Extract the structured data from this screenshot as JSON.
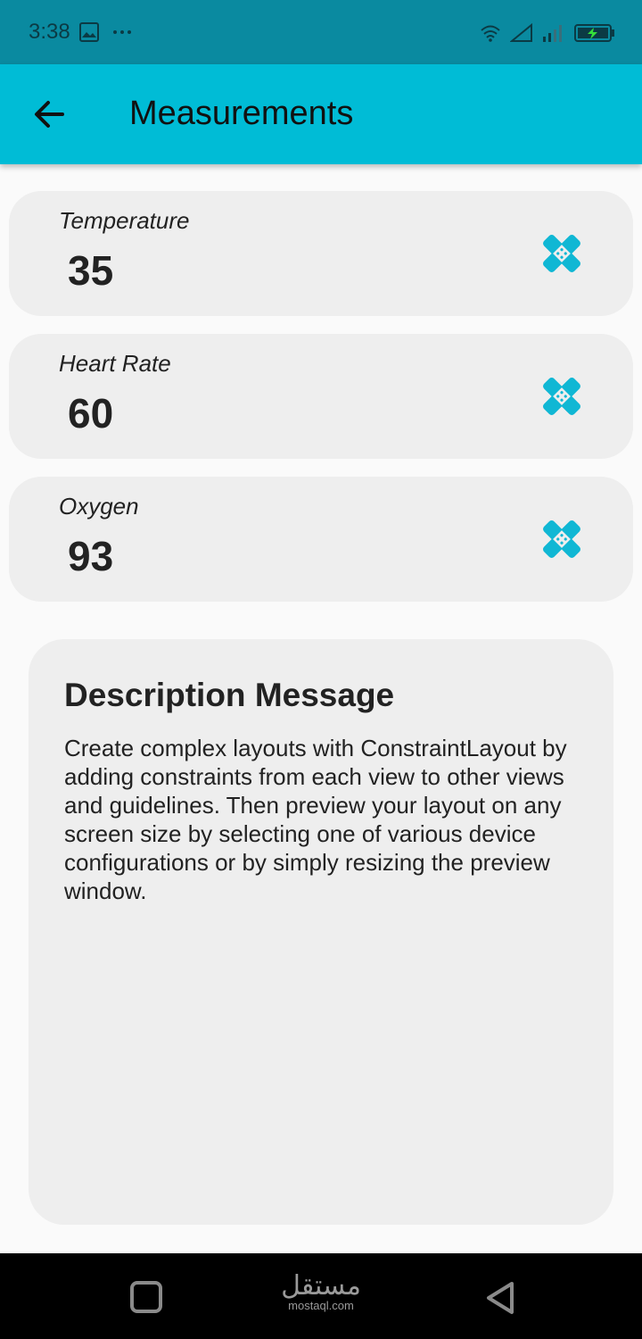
{
  "status_bar": {
    "time": "3:38",
    "left_icons": [
      "gallery-icon",
      "more-icon"
    ],
    "right_icons": [
      "wifi-icon",
      "signal-icon",
      "signal-bars-icon",
      "battery-charging-icon"
    ],
    "battery_color": "#35e03a"
  },
  "app_bar": {
    "title": "Measurements",
    "back_icon": "arrow-left-icon",
    "background": "#00bcd6"
  },
  "measurements": [
    {
      "label": "Temperature",
      "value": "35",
      "icon": "bandage-icon"
    },
    {
      "label": "Heart Rate",
      "value": "60",
      "icon": "bandage-icon"
    },
    {
      "label": "Oxygen",
      "value": "93",
      "icon": "bandage-icon"
    }
  ],
  "description": {
    "title": "Description Message",
    "body": "Create complex layouts with ConstraintLayout by adding constraints from each view to other views and guidelines. Then preview your layout on any screen size by selecting one of various device configurations or by simply resizing the preview window."
  },
  "nav_bar": {
    "home_icon": "square-icon",
    "watermark_ar": "مستقل",
    "watermark_en": "mostaql.com",
    "back_icon": "triangle-back-icon"
  },
  "colors": {
    "accent": "#00bcd6",
    "status_bar": "#0a8aa0",
    "card": "#eeeeee",
    "icon": "#10b7d4"
  }
}
